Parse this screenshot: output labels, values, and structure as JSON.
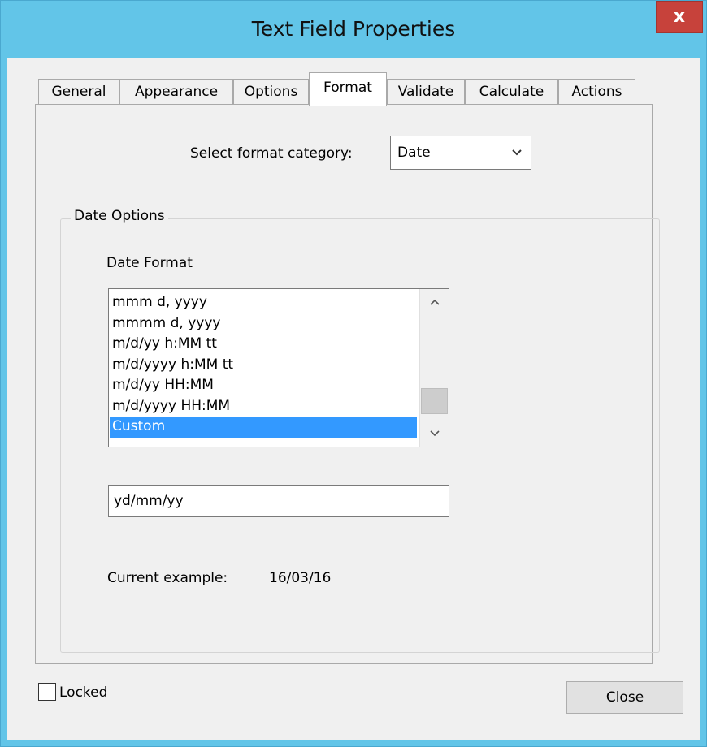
{
  "window": {
    "title": "Text Field Properties",
    "close_glyph": "x"
  },
  "tabs": [
    {
      "label": "General"
    },
    {
      "label": "Appearance"
    },
    {
      "label": "Options"
    },
    {
      "label": "Format"
    },
    {
      "label": "Validate"
    },
    {
      "label": "Calculate"
    },
    {
      "label": "Actions"
    }
  ],
  "active_tab": "Format",
  "format": {
    "category_label": "Select format category:",
    "category_value": "Date",
    "dropdown_icon": "chevron-down-icon",
    "group_title": "Date Options",
    "date_format_label": "Date Format",
    "date_formats": [
      "mmm d, yyyy",
      "mmmm d, yyyy",
      "m/d/yy h:MM tt",
      "m/d/yyyy h:MM tt",
      "m/d/yy HH:MM",
      "m/d/yyyy HH:MM",
      "Custom"
    ],
    "selected_format": "Custom",
    "custom_value": "yd/mm/yy",
    "example_label": "Current example:",
    "example_value": "16/03/16"
  },
  "footer": {
    "locked_label": "Locked",
    "locked_checked": false,
    "close_label": "Close"
  }
}
